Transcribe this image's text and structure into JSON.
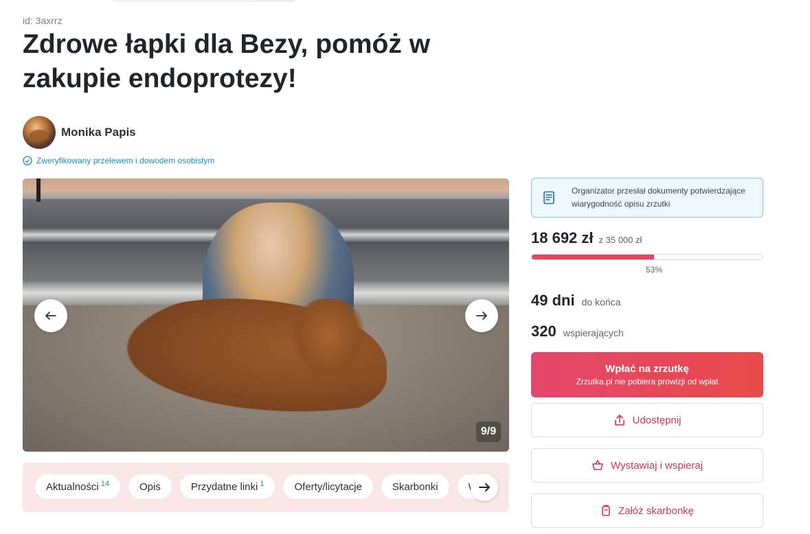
{
  "campaign": {
    "id_label": "id: 3axrrz",
    "title": "Zdrowe łapki dla Bezy, pomóż w zakupie endoprotezy!"
  },
  "organizer": {
    "name": "Monika Papis",
    "verified_text": "Zweryfikowany przelewem i dowodem osobistym"
  },
  "gallery": {
    "counter": "9/9",
    "prev_icon": "arrow-left-icon",
    "next_icon": "arrow-right-icon"
  },
  "tabs": {
    "items": [
      {
        "label": "Aktualności",
        "badge": "14"
      },
      {
        "label": "Opis",
        "badge": ""
      },
      {
        "label": "Przydatne linki",
        "badge": "1"
      },
      {
        "label": "Oferty/licytacje",
        "badge": ""
      },
      {
        "label": "Skarbonki",
        "badge": ""
      },
      {
        "label": "W",
        "badge": ""
      }
    ]
  },
  "sidebar": {
    "docs_note": "Organizator przesłał dokumenty potwierdzające wiarygodność opisu zrzutki",
    "amount": "18 692 zł",
    "goal": "z 35 000 zł",
    "progress_fraction": 0.53,
    "percent_label": "53%",
    "days_num": "49 dni",
    "days_label": "do końca",
    "backers_num": "320",
    "backers_label": "wspierających",
    "pay_button": "Wpłać na zrzutkę",
    "pay_subtext": "Zrzutka.pl nie pobiera prowizji od wpłat",
    "share_button": "Udostępnij",
    "sell_button": "Wystawiaj i wspieraj",
    "piggy_button": "Załóż skarbonkę"
  },
  "colors": {
    "accent": "#e2455c",
    "link": "#1f8fb8",
    "tabs_bg": "#fbe6e8"
  }
}
